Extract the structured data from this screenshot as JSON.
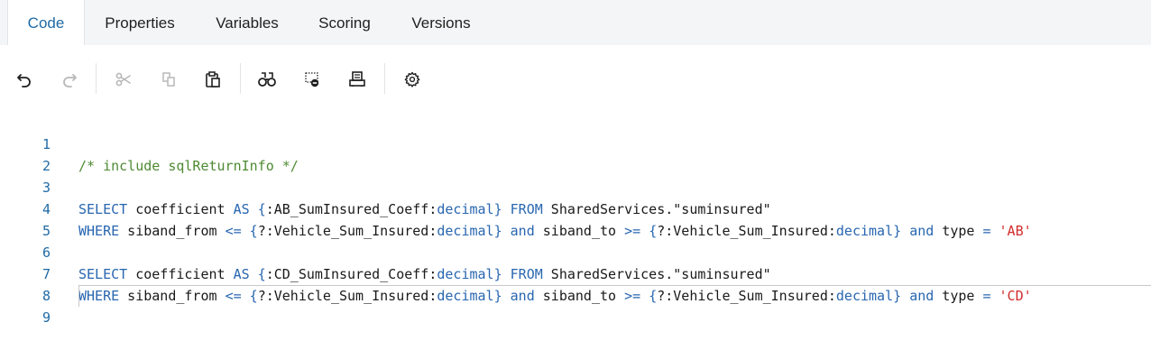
{
  "tabs": [
    {
      "label": "Code",
      "active": true
    },
    {
      "label": "Properties",
      "active": false
    },
    {
      "label": "Variables",
      "active": false
    },
    {
      "label": "Scoring",
      "active": false
    },
    {
      "label": "Versions",
      "active": false
    }
  ],
  "toolbar": {
    "icons": [
      "undo-icon",
      "redo-icon",
      "cut-icon",
      "copy-icon",
      "paste-icon",
      "find-icon",
      "toggle-breakpoint-icon",
      "print-icon",
      "settings-icon"
    ],
    "disabled": [
      "redo-icon",
      "cut-icon",
      "copy-icon"
    ]
  },
  "colors": {
    "accent": "#1f6aa6",
    "keyword": "#2866b0",
    "comment": "#4e8a33",
    "string": "#d22c2c",
    "tabbar_bg": "#f4f5f7"
  },
  "editor": {
    "line_numbers": [
      "1",
      "2",
      "3",
      "4",
      "5",
      "6",
      "7",
      "8",
      "9"
    ],
    "line1": {
      "comment": "/* include sqlReturnInfo */"
    },
    "line3": {
      "kw1": "SELECT",
      "t1": " coefficient ",
      "kw2": "AS",
      "t2": " ",
      "b1": "{",
      "t3": ":AB_SumInsured_Coeff:",
      "kw3": "decimal",
      "b2": "}",
      "t4": " ",
      "kw4": "FROM",
      "t5": " SharedServices.\"suminsured\""
    },
    "line4": {
      "kw1": "WHERE",
      "t1": " siband_from ",
      "op1": "<=",
      "t2": " ",
      "b1": "{",
      "t3": "?:Vehicle_Sum_Insured:",
      "kw2": "decimal",
      "b2": "}",
      "t4": " ",
      "kw3": "and",
      "t5": " siband_to ",
      "op2": ">=",
      "t6": " ",
      "b3": "{",
      "t7": "?:Vehicle_Sum_Insured:",
      "kw4": "decimal",
      "b4": "}",
      "t8": " ",
      "kw5": "and",
      "t9": " type ",
      "op3": "=",
      "t10": " ",
      "st": "'AB'"
    },
    "line6": {
      "kw1": "SELECT",
      "t1": " coefficient ",
      "kw2": "AS",
      "t2": " ",
      "b1": "{",
      "t3": ":CD_SumInsured_Coeff:",
      "kw3": "decimal",
      "b2": "}",
      "t4": " ",
      "kw4": "FROM",
      "t5": " SharedServices.\"suminsured\""
    },
    "line7": {
      "kw1": "WHERE",
      "t1": " siband_from ",
      "op1": "<=",
      "t2": " ",
      "b1": "{",
      "t3": "?:Vehicle_Sum_Insured:",
      "kw2": "decimal",
      "b2": "}",
      "t4": " ",
      "kw3": "and",
      "t5": " siband_to ",
      "op2": ">=",
      "t6": " ",
      "b3": "{",
      "t7": "?:Vehicle_Sum_Insured:",
      "kw4": "decimal",
      "b4": "}",
      "t8": " ",
      "kw5": "and",
      "t9": " type ",
      "op3": "=",
      "t10": " ",
      "st": "'CD'"
    }
  }
}
